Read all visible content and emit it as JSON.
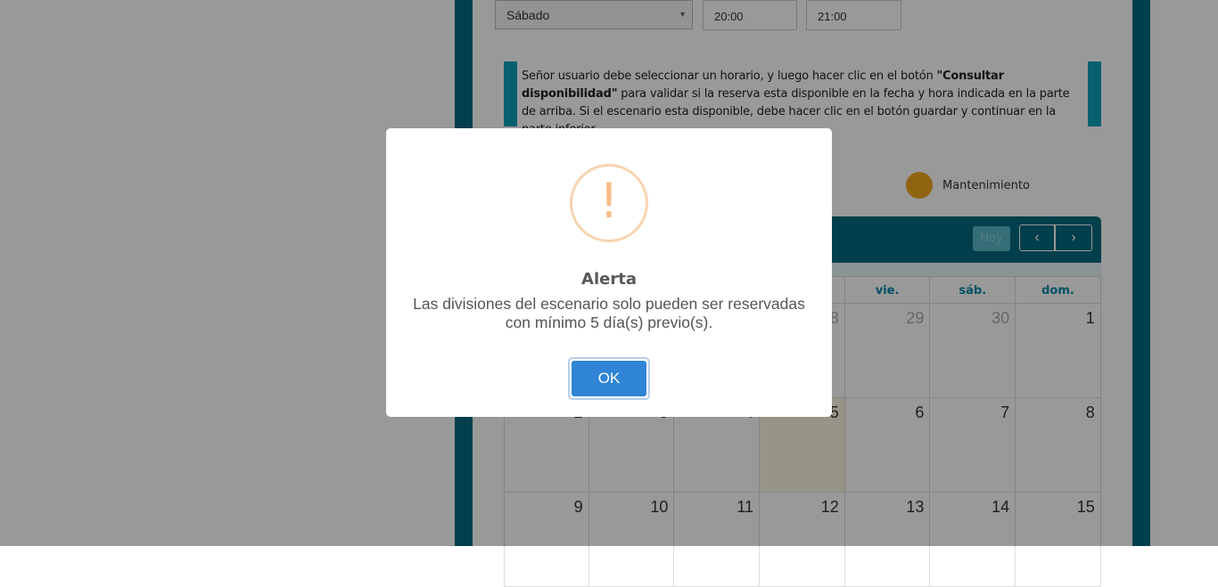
{
  "form": {
    "day_select": "Sábado",
    "start_time": "20:00",
    "end_time": "21:00"
  },
  "info": {
    "text_before": "Señor usuario debe seleccionar un horario, y luego hacer clic en el botón ",
    "bold": "\"Consultar disponibilidad\"",
    "text_after": " para validar si la reserva esta disponible en la fecha y hora indicada en la parte de arriba. Si el escenario esta disponible, debe hacer clic en el botón guardar y continuar en la parte inferior."
  },
  "legend": {
    "maintenance_label": "Mantenimiento",
    "maintenance_color": "#f0a81e"
  },
  "calendar": {
    "today_button": "Hoy",
    "prev_icon": "chevron-left-icon",
    "next_icon": "chevron-right-icon",
    "weekdays": [
      "",
      "",
      "",
      "",
      "vie.",
      "sáb.",
      "dom."
    ],
    "weeks": [
      [
        "",
        "",
        "",
        "28",
        "29",
        "30",
        "1"
      ],
      [
        "2",
        "3",
        "4",
        "5",
        "6",
        "7",
        "8"
      ],
      [
        "9",
        "10",
        "11",
        "12",
        "13",
        "14",
        "15"
      ]
    ]
  },
  "dialog": {
    "icon": "warning-icon",
    "title": "Alerta",
    "message": "Las divisiones del escenario solo pueden ser reservadas con mínimo 5 día(s) previo(s).",
    "ok_label": "OK",
    "ok_color": "#3085d6"
  }
}
